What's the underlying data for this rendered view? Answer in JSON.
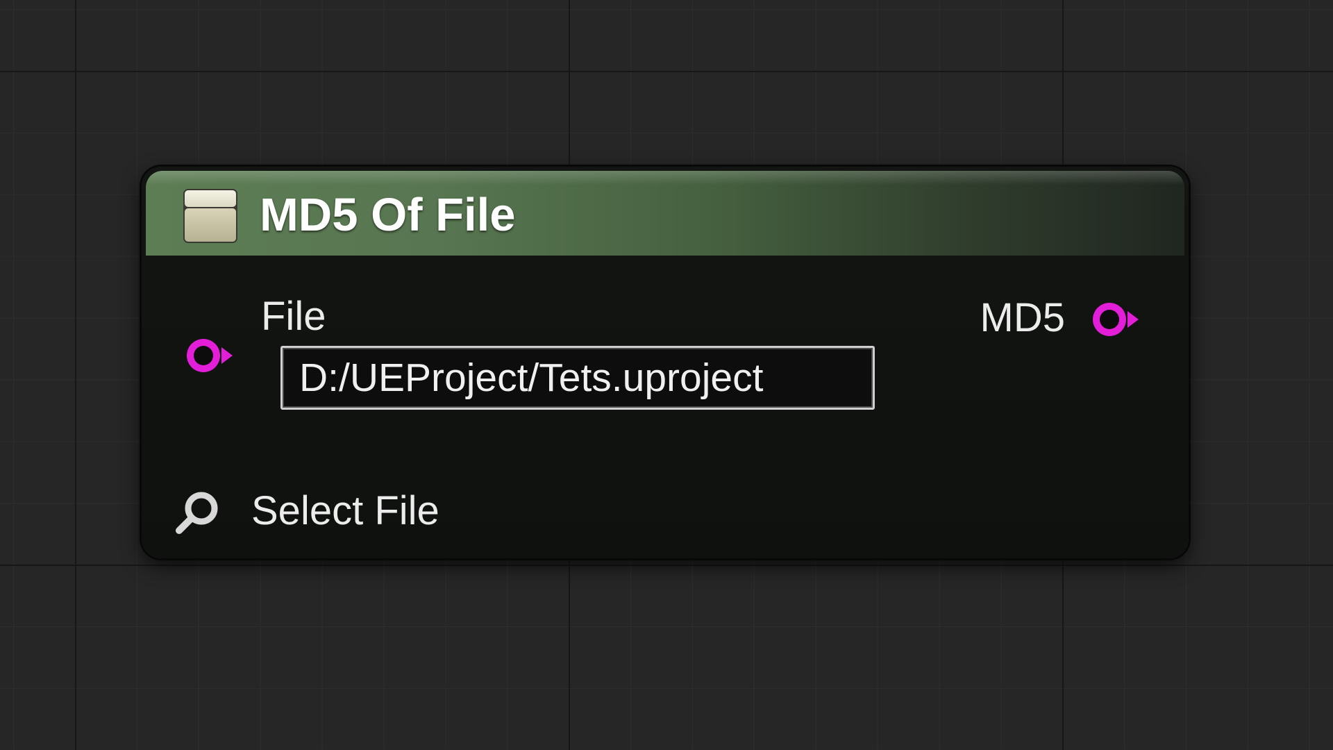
{
  "graph_node": {
    "title": "MD5 Of File",
    "header_icon": "function-box-icon",
    "accent_header_color": "#587651",
    "pin_color": "#e31ed9",
    "inputs": {
      "file_label": "File",
      "file_value": "D:/UEProject/Tets.uproject"
    },
    "outputs": {
      "md5_label": "MD5"
    },
    "select_file": {
      "label": "Select File",
      "icon": "search-icon"
    }
  }
}
